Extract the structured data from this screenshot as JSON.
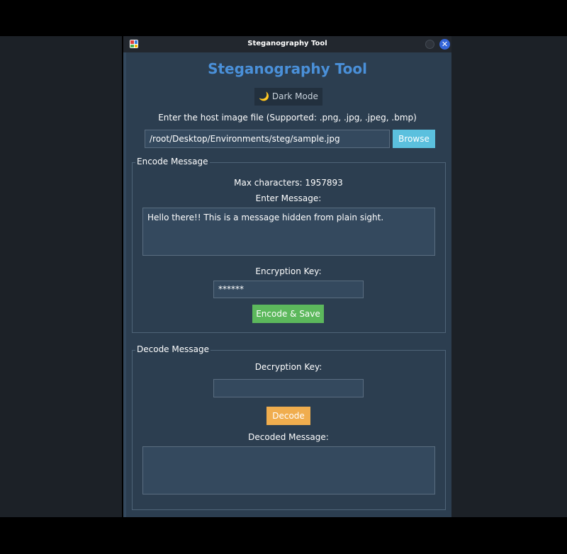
{
  "window": {
    "title": "Steganography Tool"
  },
  "app": {
    "heading": "Steganography Tool",
    "dark_mode_label": "Dark Mode",
    "dark_mode_icon": "moon-icon",
    "host_file_label": "Enter the host image file (Supported: .png, .jpg, .jpeg, .bmp)",
    "host_file_path": "/root/Desktop/Environments/steg/sample.jpg",
    "browse_label": "Browse"
  },
  "encode": {
    "group_title": "Encode Message",
    "max_chars_label": "Max characters: 1957893",
    "message_label": "Enter Message:",
    "message_value": "Hello there!! This is a message hidden from plain sight.",
    "key_label": "Encryption Key:",
    "key_value": "******",
    "button_label": "Encode & Save"
  },
  "decode": {
    "group_title": "Decode Message",
    "key_label": "Decryption Key:",
    "key_value": "",
    "button_label": "Decode",
    "output_label": "Decoded Message:",
    "output_value": ""
  },
  "colors": {
    "window_bg": "#2c3e50",
    "heading": "#4a90d9",
    "browse": "#5bc0de",
    "encode": "#5cb85c",
    "decode": "#f0ad4e",
    "close": "#3465d9"
  }
}
